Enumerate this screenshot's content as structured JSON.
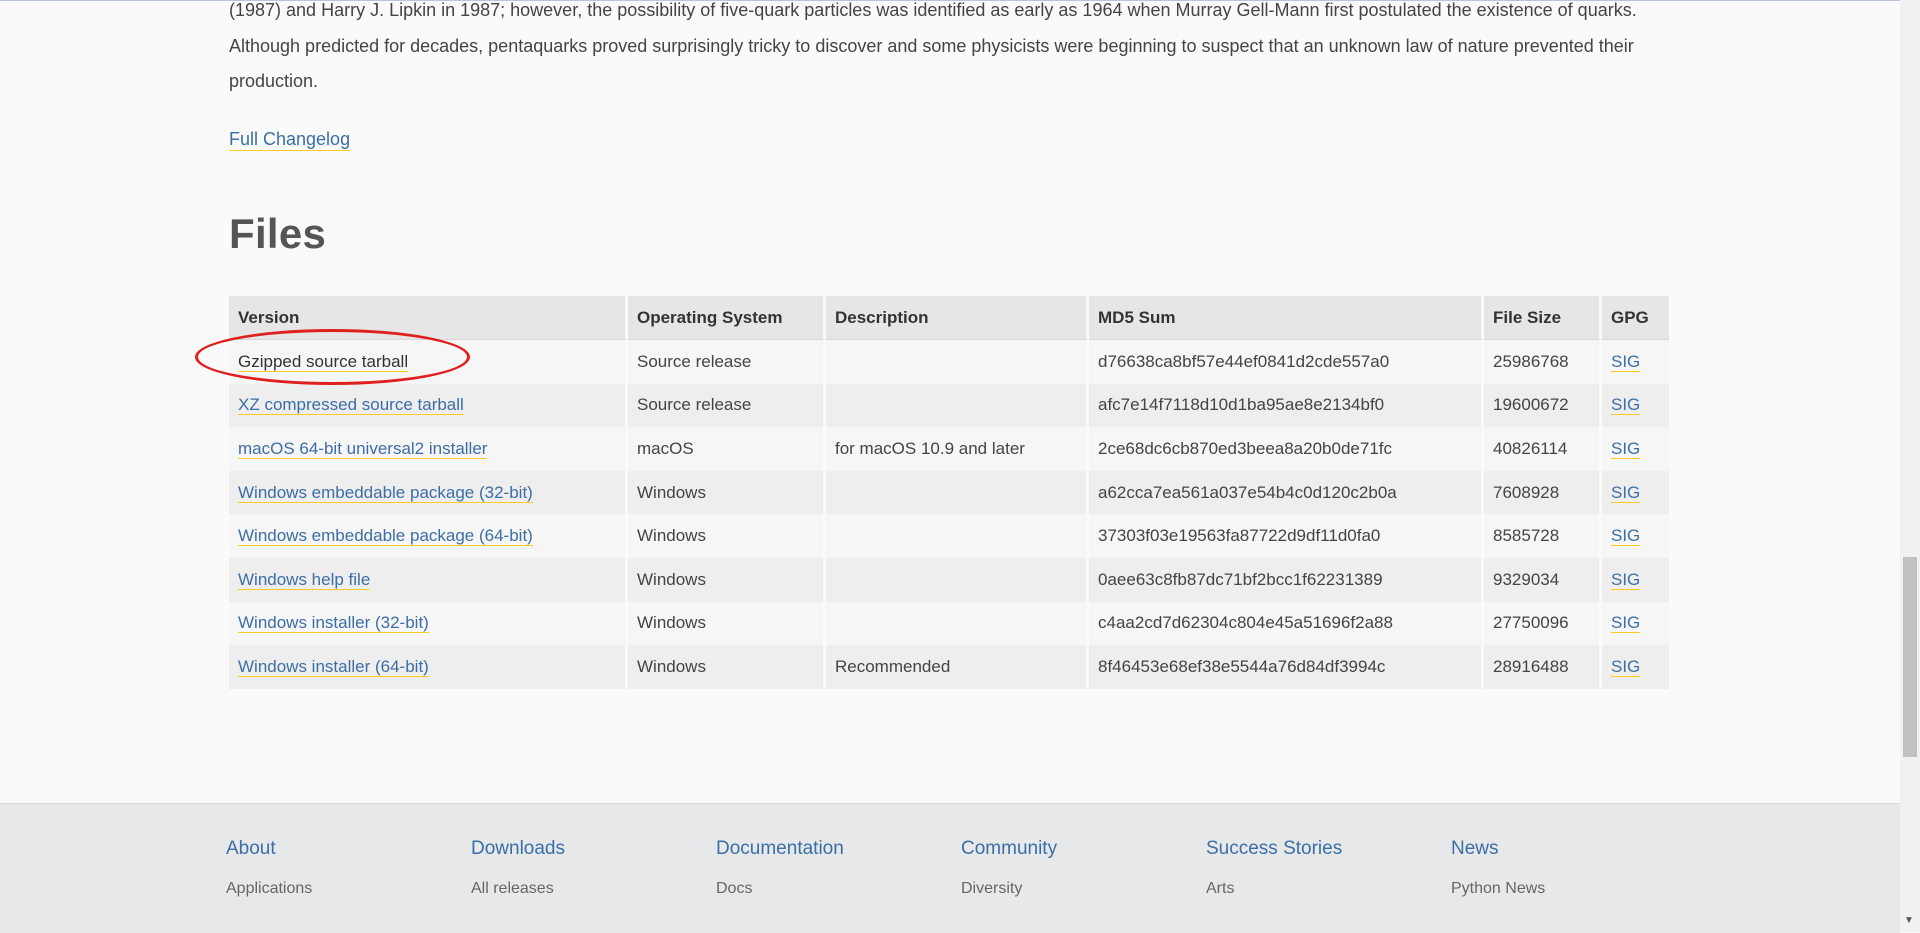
{
  "intro": {
    "text": "(1987) and Harry J. Lipkin in 1987; however, the possibility of five-quark particles was identified as early as 1964 when Murray Gell-Mann first postulated the existence of quarks. Although predicted for decades, pentaquarks proved surprisingly tricky to discover and some physicists were beginning to suspect that an unknown law of nature prevented their production."
  },
  "changelog_label": "Full Changelog",
  "files": {
    "title": "Files",
    "headers": [
      "Version",
      "Operating System",
      "Description",
      "MD5 Sum",
      "File Size",
      "GPG"
    ],
    "rows": [
      {
        "version": "Gzipped source tarball",
        "os": "Source release",
        "description": "",
        "md5": "d76638ca8bf57e44ef0841d2cde557a0",
        "size": "25986768",
        "gpg": "SIG"
      },
      {
        "version": "XZ compressed source tarball",
        "os": "Source release",
        "description": "",
        "md5": "afc7e14f7118d10d1ba95ae8e2134bf0",
        "size": "19600672",
        "gpg": "SIG"
      },
      {
        "version": "macOS 64-bit universal2 installer",
        "os": "macOS",
        "description": "for macOS 10.9 and later",
        "md5": "2ce68dc6cb870ed3beea8a20b0de71fc",
        "size": "40826114",
        "gpg": "SIG"
      },
      {
        "version": "Windows embeddable package (32-bit)",
        "os": "Windows",
        "description": "",
        "md5": "a62cca7ea561a037e54b4c0d120c2b0a",
        "size": "7608928",
        "gpg": "SIG"
      },
      {
        "version": "Windows embeddable package (64-bit)",
        "os": "Windows",
        "description": "",
        "md5": "37303f03e19563fa87722d9df11d0fa0",
        "size": "8585728",
        "gpg": "SIG"
      },
      {
        "version": "Windows help file",
        "os": "Windows",
        "description": "",
        "md5": "0aee63c8fb87dc71bf2bcc1f62231389",
        "size": "9329034",
        "gpg": "SIG"
      },
      {
        "version": "Windows installer (32-bit)",
        "os": "Windows",
        "description": "",
        "md5": "c4aa2cd7d62304c804e45a51696f2a88",
        "size": "27750096",
        "gpg": "SIG"
      },
      {
        "version": "Windows installer (64-bit)",
        "os": "Windows",
        "description": "Recommended",
        "md5": "8f46453e68ef38e5544a76d84df3994c",
        "size": "28916488",
        "gpg": "SIG"
      }
    ]
  },
  "footer": {
    "columns": [
      {
        "heading": "About",
        "first_item": "Applications"
      },
      {
        "heading": "Downloads",
        "first_item": "All releases"
      },
      {
        "heading": "Documentation",
        "first_item": "Docs"
      },
      {
        "heading": "Community",
        "first_item": "Diversity"
      },
      {
        "heading": "Success Stories",
        "first_item": "Arts"
      },
      {
        "heading": "News",
        "first_item": "Python News"
      }
    ]
  },
  "colors": {
    "link": "#3c6ea6",
    "link_underline": "#ffc91f",
    "highlight_circle": "#e0201e"
  }
}
